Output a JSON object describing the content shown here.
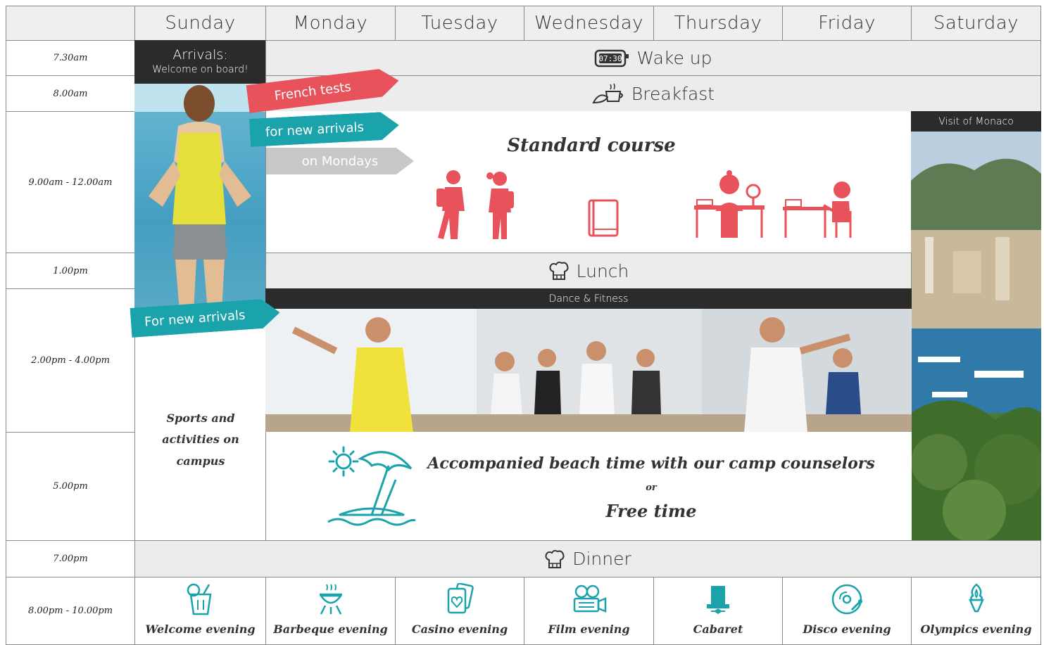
{
  "days": [
    "Sunday",
    "Monday",
    "Tuesday",
    "Wednesday",
    "Thursday",
    "Friday",
    "Saturday"
  ],
  "times": [
    "7.30am",
    "8.00am",
    "9.00am - 12.00am",
    "1.00pm",
    "2.00pm - 4.00pm",
    "5.00pm",
    "7.00pm",
    "8.00pm - 10.00pm"
  ],
  "arrivals": {
    "title": "Arrivals:",
    "subtitle": "Welcome on board!"
  },
  "wake_up": "Wake up",
  "clock_text": "07:30",
  "breakfast": "Breakfast",
  "ribbons": {
    "french_tests": "French tests",
    "for_new_arrivals": "for new arrivals",
    "on_mondays": "on Mondays",
    "for_new_arrivals_afternoon": "For new arrivals"
  },
  "standard_course": "Standard course",
  "visit_monaco": "Visit of Monaco",
  "lunch": "Lunch",
  "dance_fitness": "Dance & Fitness",
  "sports": "Sports and activities on campus",
  "beach": {
    "line1": "Accompanied beach time with our camp counselors",
    "or": "or",
    "line2": "Free time"
  },
  "dinner": "Dinner",
  "evenings": [
    {
      "label": "Welcome evening",
      "icon": "cocktail-icon"
    },
    {
      "label": "Barbeque evening",
      "icon": "barbecue-icon"
    },
    {
      "label": "Casino evening",
      "icon": "playing-cards-icon"
    },
    {
      "label": "Film evening",
      "icon": "film-camera-icon"
    },
    {
      "label": "Cabaret",
      "icon": "top-hat-icon"
    },
    {
      "label": "Disco evening",
      "icon": "vinyl-record-icon"
    },
    {
      "label": "Olympics evening",
      "icon": "torch-icon"
    }
  ],
  "colors": {
    "teal": "#1aa3ab",
    "coral": "#e8525b",
    "grey": "#c8c8c8",
    "band": "#ececec",
    "dark": "#2b2b2b"
  }
}
